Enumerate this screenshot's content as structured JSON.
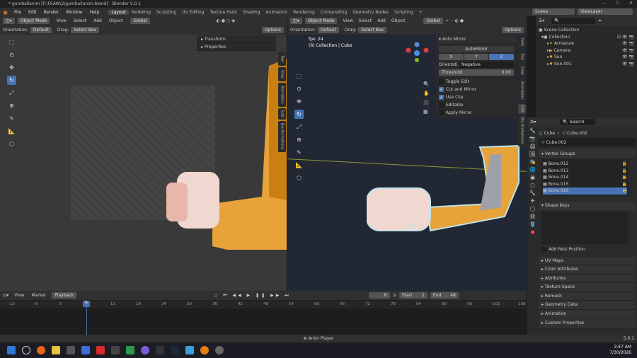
{
  "window": {
    "title": "* gumballanim [F:\\FSAW\\2\\gumballanim.blend] - Blender 5.0.1"
  },
  "menu": {
    "items": [
      "File",
      "Edit",
      "Render",
      "Window",
      "Help"
    ],
    "tabs": [
      "Layout",
      "Modeling",
      "Sculpting",
      "UV Editing",
      "Texture Paint",
      "Shading",
      "Animation",
      "Rendering",
      "Compositing",
      "Geometry Nodes",
      "Scripting"
    ],
    "add_tab": "+",
    "scene": "Scene",
    "view_layer": "ViewLayer"
  },
  "viewport_left": {
    "mode": "Object Mode",
    "menus": [
      "View",
      "Select",
      "Add",
      "Object"
    ],
    "transform": "Global",
    "orientation_label": "Orientation:",
    "orientation": "Default",
    "drag_label": "Drag:",
    "drag": "Select Box",
    "options": "Options",
    "panels": [
      "Transform",
      "Properties"
    ],
    "tabs": [
      "Tool",
      "View",
      "Animation",
      "Edit",
      "Bix Animations"
    ]
  },
  "viewport_right": {
    "mode": "Object Mode",
    "menus": [
      "View",
      "Select",
      "Add",
      "Object"
    ],
    "transform": "Global",
    "orientation_label": "Orientation:",
    "orientation": "Default",
    "drag_label": "Drag:",
    "drag": "Select Box",
    "options": "Options",
    "fps": "fps: 24",
    "collection": "(6) Collection | Cube",
    "tabs": [
      "Item",
      "Tool",
      "View",
      "Animation",
      "Edit",
      "Bix Animations"
    ],
    "automirror": {
      "title": "Auto Mirror",
      "button": "AutoMirror",
      "axes": [
        "X",
        "Y",
        "Z"
      ],
      "orientation_label": "Orientati...",
      "orientation_value": "Negative",
      "threshold_label": "Threshold",
      "threshold_value": "0.00",
      "checks": [
        {
          "label": "Toggle Edit",
          "checked": false
        },
        {
          "label": "Cut and Mirror",
          "checked": true
        },
        {
          "label": "Use Clip",
          "checked": true
        },
        {
          "label": "Editable",
          "checked": false
        },
        {
          "label": "Apply Mirror",
          "checked": false
        }
      ]
    }
  },
  "outliner": {
    "search_placeholder": "",
    "root": "Scene Collection",
    "items": [
      {
        "label": "Collection",
        "depth": 0
      },
      {
        "label": "Armature",
        "depth": 1
      },
      {
        "label": "Camera",
        "depth": 1
      },
      {
        "label": "Sun",
        "depth": 1
      },
      {
        "label": "Sun.001",
        "depth": 1
      }
    ]
  },
  "properties": {
    "search_placeholder": "Search",
    "breadcrumb_object": "Cube",
    "breadcrumb_data": "Cube.002",
    "data_name": "Cube.002",
    "vertex_groups_title": "Vertex Groups",
    "vertex_groups": [
      "Bone.012",
      "Bone.013",
      "Bone.014",
      "Bone.015",
      "Bone.016"
    ],
    "selected_group": "Bone.016",
    "shape_keys_title": "Shape Keys",
    "add_rest": "Add Rest Position",
    "sections": [
      "UV Maps",
      "Color Attributes",
      "Attributes",
      "Texture Space",
      "Remesh",
      "Geometry Data",
      "Animation",
      "Custom Properties"
    ]
  },
  "timeline": {
    "menus": [
      "View",
      "Marker"
    ],
    "playback": "Playback",
    "current_frame": "6",
    "start_label": "Start",
    "start": "1",
    "end_label": "End",
    "end": "48",
    "ticks": [
      "-12",
      "-6",
      "0",
      "6",
      "12",
      "18",
      "24",
      "30",
      "36",
      "42",
      "48",
      "54",
      "60",
      "66",
      "72",
      "78",
      "84",
      "90",
      "96",
      "102",
      "108"
    ],
    "playhead": "6"
  },
  "statusbar": {
    "center": "Anim Player",
    "version": "5.0.1"
  },
  "taskbar": {
    "time": "3:47 AM",
    "date": "7/30/2026"
  },
  "colors": {
    "accent": "#4772b3",
    "orange": "#e8a23a",
    "bg": "#1d1d1d",
    "header": "#303030"
  }
}
